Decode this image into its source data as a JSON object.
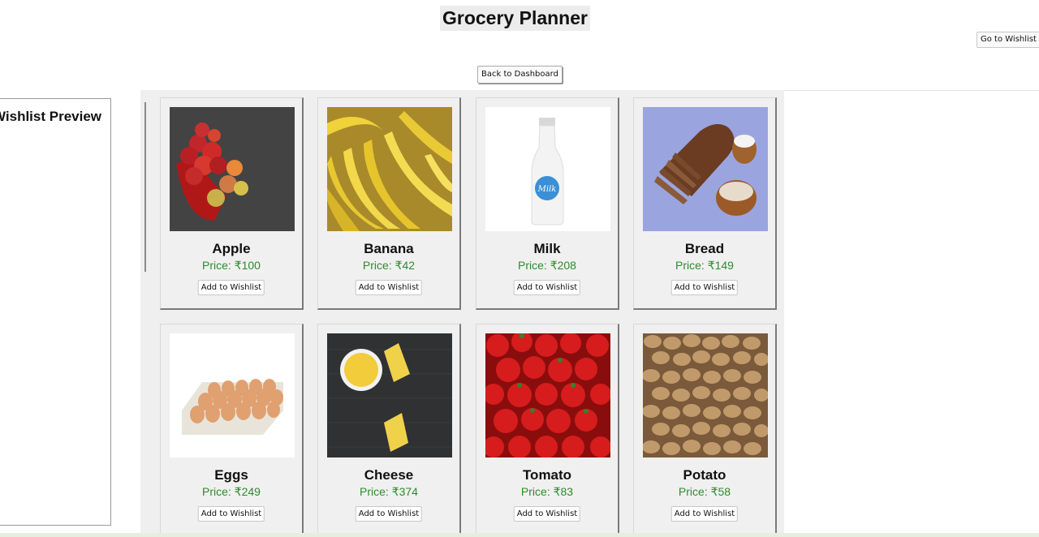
{
  "header": {
    "title": "Grocery Planner"
  },
  "toolbar": {
    "goto_wishlist_label": "Go to Wishlist",
    "back_label": "Back to Dashboard"
  },
  "wishlist": {
    "title": "Wishlist Preview"
  },
  "products": [
    {
      "name": "Apple",
      "price": "Price: ₹100",
      "button": "Add to Wishlist"
    },
    {
      "name": "Banana",
      "price": "Price: ₹42",
      "button": "Add to Wishlist"
    },
    {
      "name": "Milk",
      "price": "Price: ₹208",
      "button": "Add to Wishlist"
    },
    {
      "name": "Bread",
      "price": "Price: ₹149",
      "button": "Add to Wishlist"
    },
    {
      "name": "Eggs",
      "price": "Price: ₹249",
      "button": "Add to Wishlist"
    },
    {
      "name": "Cheese",
      "price": "Price: ₹374",
      "button": "Add to Wishlist"
    },
    {
      "name": "Tomato",
      "price": "Price: ₹83",
      "button": "Add to Wishlist"
    },
    {
      "name": "Potato",
      "price": "Price: ₹58",
      "button": "Add to Wishlist"
    }
  ],
  "images": {
    "milk_label": "Milk"
  },
  "colors": {
    "price": "#2e8b2e",
    "grid_background": "#efefef",
    "title_background": "#ececec"
  }
}
